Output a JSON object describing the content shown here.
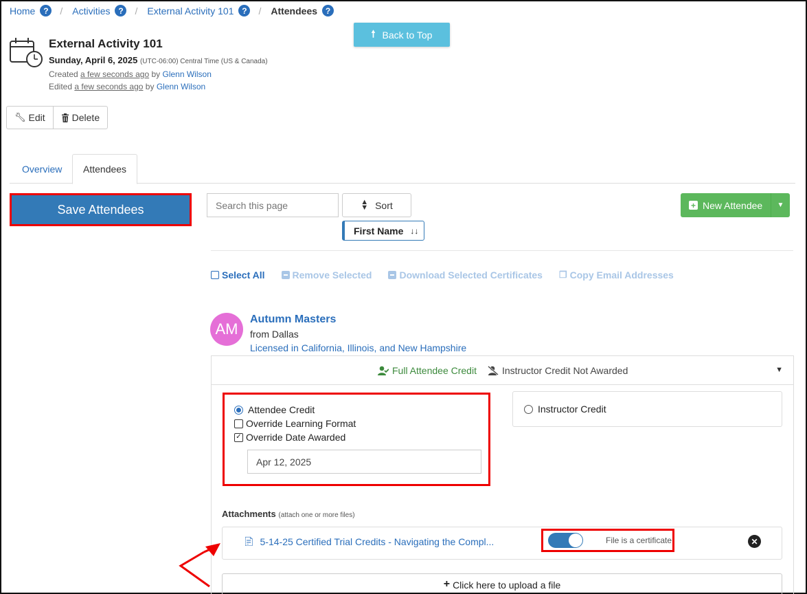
{
  "breadcrumb": {
    "items": [
      {
        "label": "Home"
      },
      {
        "label": "Activities"
      },
      {
        "label": "External Activity 101"
      }
    ],
    "current": "Attendees",
    "help_glyph": "?",
    "separator": "/"
  },
  "back_to_top": "Back to Top",
  "activity": {
    "title": "External Activity 101",
    "date": "Sunday, April 6, 2025",
    "timezone": "(UTC-06:00) Central Time (US & Canada)",
    "created_prefix": "Created",
    "created_when": "a few seconds ago",
    "created_by_word": "by",
    "created_by": "Glenn Wilson",
    "edited_prefix": "Edited",
    "edited_when": "a few seconds ago",
    "edited_by_word": "by",
    "edited_by": "Glenn Wilson"
  },
  "toolbar": {
    "edit": "Edit",
    "delete": "Delete"
  },
  "tabs": [
    {
      "label": "Overview"
    },
    {
      "label": "Attendees"
    }
  ],
  "save_button": "Save Attendees",
  "search": {
    "placeholder": "Search this page"
  },
  "sort": {
    "label": "Sort",
    "field": "First Name"
  },
  "new_attendee": "New Attendee",
  "bulk_actions": {
    "select_all": "Select All",
    "remove_selected": "Remove Selected",
    "download_certificates": "Download Selected Certificates",
    "copy_emails": "Copy Email Addresses"
  },
  "attendee": {
    "initials": "AM",
    "name": "Autumn Masters",
    "from": "from Dallas",
    "licensed": "Licensed in California, Illinois, and New Hampshire",
    "full_credit": "Full Attendee Credit",
    "instructor_status": "Instructor Credit Not Awarded",
    "attendee_credit": "Attendee Credit",
    "override_format": "Override Learning Format",
    "override_date": "Override Date Awarded",
    "date_awarded": "Apr 12, 2025",
    "instructor_credit": "Instructor Credit"
  },
  "attachments": {
    "label": "Attachments",
    "hint": "(attach one or more files)",
    "file_name": "5-14-25 Certified Trial Credits - Navigating the Compl...",
    "certificate_label": "File is a certificate",
    "upload_label": "Click here to upload a file"
  },
  "colors": {
    "link": "#2a6ebb",
    "primary": "#337ab7",
    "success": "#5cb85c",
    "info": "#5bc0de",
    "avatar": "#e56fd7",
    "highlight": "#ee0000"
  }
}
